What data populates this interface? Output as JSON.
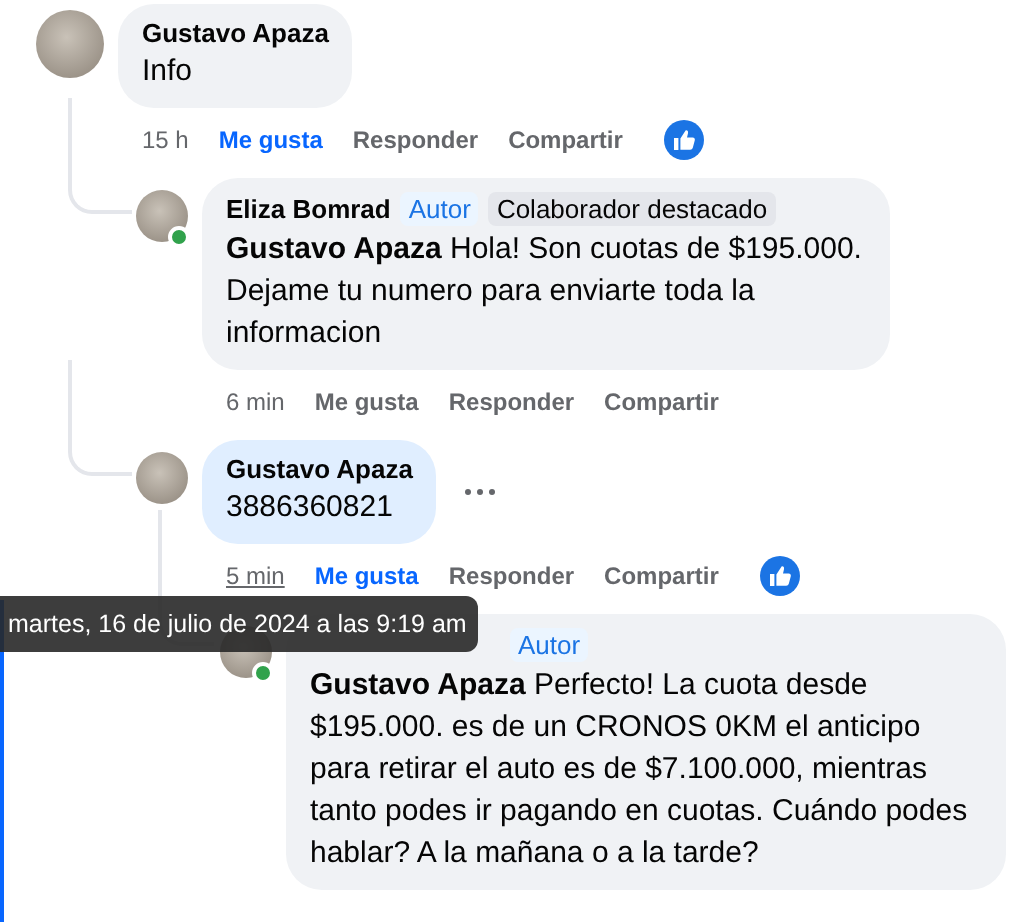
{
  "comments": [
    {
      "author": "Gustavo Apaza",
      "text": "Info",
      "online": false,
      "highlighted": false,
      "more": false,
      "time": "15 h",
      "liked": true,
      "like_label": "Me gusta",
      "reply_label": "Responder",
      "share_label": "Compartir",
      "reacted": true,
      "children": [
        {
          "author": "Eliza Bomrad",
          "badges": [
            {
              "label": "Autor",
              "kind": "author"
            },
            {
              "label": "Colaborador destacado",
              "kind": "top"
            }
          ],
          "text": "**Gustavo Apaza** Hola! Son cuotas de $195.000. Dejame tu numero para enviarte toda la informacion",
          "online": true,
          "highlighted": false,
          "more": false,
          "time": "6 min",
          "liked": false,
          "like_label": "Me gusta",
          "reply_label": "Responder",
          "share_label": "Compartir",
          "reacted": false
        },
        {
          "author": "Gustavo Apaza",
          "text": "3886360821",
          "online": false,
          "highlighted": true,
          "more": true,
          "time": "5 min",
          "liked": true,
          "like_label": "Me gusta",
          "reply_label": "Responder",
          "share_label": "Compartir",
          "reacted": true,
          "children": [
            {
              "badges": [
                {
                  "label": "Autor",
                  "kind": "author"
                }
              ],
              "text": "**Gustavo Apaza** Perfecto! La cuota desde $195.000. es de un CRONOS 0KM el anticipo para retirar el auto es de $7.100.000, mientras tanto podes ir pagando en cuotas. Cuándo podes hablar? A la mañana o a la tarde?",
              "online": true,
              "highlighted": false,
              "more": false
            }
          ]
        }
      ]
    }
  ],
  "tooltip": {
    "text": "martes, 16 de julio de 2024 a las 9:19 am"
  }
}
